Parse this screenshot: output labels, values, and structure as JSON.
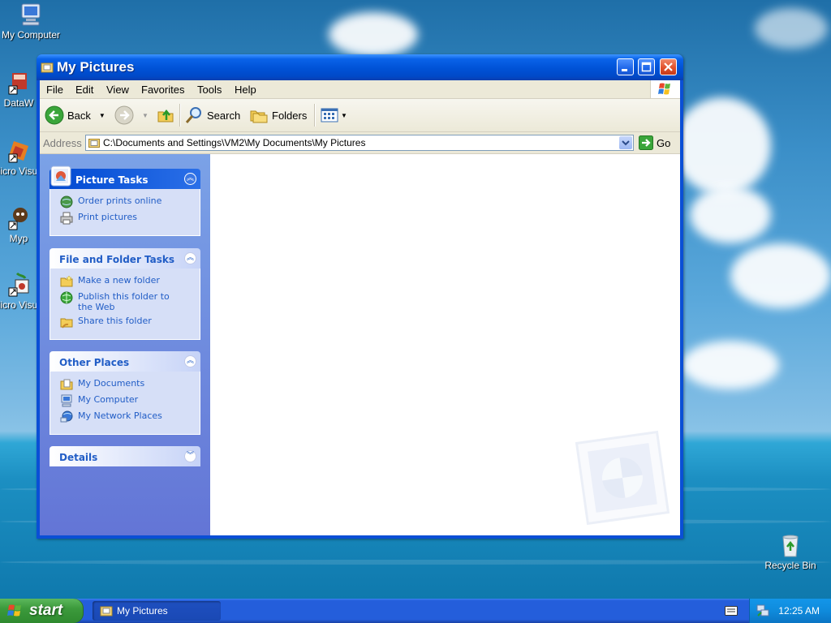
{
  "desktop": {
    "icons": [
      {
        "label": "My Computer"
      },
      {
        "label": "DataW"
      },
      {
        "label": "Micro Visual"
      },
      {
        "label": "Myp"
      },
      {
        "label": "Micro Visual"
      },
      {
        "label": "Recycle Bin"
      }
    ]
  },
  "window": {
    "title": "My Pictures",
    "menu": [
      "File",
      "Edit",
      "View",
      "Favorites",
      "Tools",
      "Help"
    ],
    "toolbar": {
      "back_label": "Back",
      "search_label": "Search",
      "folders_label": "Folders"
    },
    "address": {
      "label": "Address",
      "value": "C:\\Documents and Settings\\VM2\\My Documents\\My Pictures",
      "go_label": "Go"
    },
    "panels": {
      "picture_tasks": {
        "title": "Picture Tasks",
        "items": [
          "Order prints online",
          "Print pictures"
        ]
      },
      "file_folder_tasks": {
        "title": "File and Folder Tasks",
        "items": [
          "Make a new folder",
          "Publish this folder to the Web",
          "Share this folder"
        ]
      },
      "other_places": {
        "title": "Other Places",
        "items": [
          "My Documents",
          "My Computer",
          "My Network Places"
        ]
      },
      "details": {
        "title": "Details"
      }
    }
  },
  "taskbar": {
    "start_label": "start",
    "window_button": "My Pictures",
    "clock": "12:25 AM"
  },
  "colors": {
    "titlebar": "#0052d6",
    "taskbar": "#245edb",
    "start_green": "#3c9a3c",
    "pane_blue": "#7ba2e7",
    "link_blue": "#215dc6"
  }
}
